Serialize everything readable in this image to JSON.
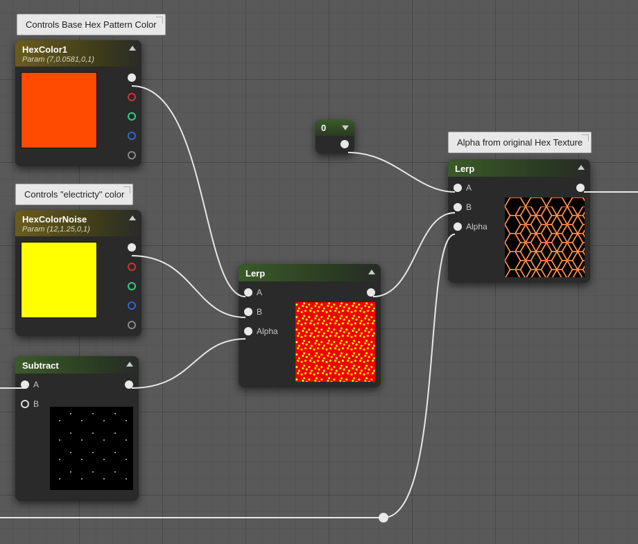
{
  "comments": {
    "c1": "Controls Base Hex Pattern Color",
    "c2": "Controls \"electricty\" color",
    "c3": "Alpha from original Hex Texture"
  },
  "hexcolor1": {
    "title": "HexColor1",
    "param": "Param (7,0.0581,0,1)"
  },
  "hexcolornoise": {
    "title": "HexColorNoise",
    "param": "Param (12,1.25,0,1)"
  },
  "subtract": {
    "title": "Subtract",
    "pin_a": "A",
    "pin_b": "B"
  },
  "lerp1": {
    "title": "Lerp",
    "pin_a": "A",
    "pin_b": "B",
    "pin_alpha": "Alpha"
  },
  "lerp2": {
    "title": "Lerp",
    "pin_a": "A",
    "pin_b": "B",
    "pin_alpha": "Alpha"
  },
  "constant": {
    "value": "0"
  }
}
